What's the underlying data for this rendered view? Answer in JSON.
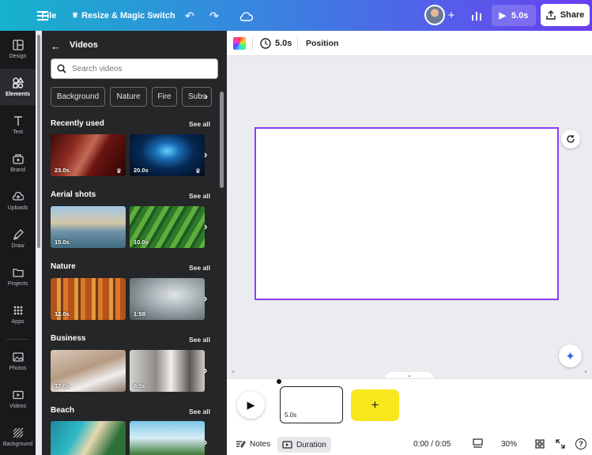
{
  "topbar": {
    "menu_icon": "hamburger-icon",
    "file_label": "File",
    "resize_label": "Resize & Magic Switch",
    "play_duration": "5.0s",
    "share_label": "Share"
  },
  "rail": {
    "items": [
      {
        "label": "Design",
        "icon": "layout-icon"
      },
      {
        "label": "Elements",
        "icon": "shapes-icon"
      },
      {
        "label": "Text",
        "icon": "text-icon"
      },
      {
        "label": "Brand",
        "icon": "brand-icon"
      },
      {
        "label": "Uploads",
        "icon": "upload-icon"
      },
      {
        "label": "Draw",
        "icon": "draw-icon"
      },
      {
        "label": "Projects",
        "icon": "folder-icon"
      },
      {
        "label": "Apps",
        "icon": "apps-icon"
      },
      {
        "label": "Photos",
        "icon": "photo-icon"
      },
      {
        "label": "Videos",
        "icon": "video-icon"
      },
      {
        "label": "Background",
        "icon": "background-icon"
      }
    ]
  },
  "panel": {
    "title": "Videos",
    "search_placeholder": "Search videos",
    "chips": [
      "Background",
      "Nature",
      "Fire",
      "Subs"
    ],
    "see_all": "See all",
    "sections": [
      {
        "title": "Recently used",
        "durations": [
          "23.0s",
          "20.0s"
        ]
      },
      {
        "title": "Aerial shots",
        "durations": [
          "15.0s",
          "10.0s"
        ]
      },
      {
        "title": "Nature",
        "durations": [
          "12.0s",
          "1:58"
        ]
      },
      {
        "title": "Business",
        "durations": [
          "17.0s",
          "8.0s"
        ]
      },
      {
        "title": "Beach",
        "durations": [
          "",
          ""
        ]
      }
    ]
  },
  "context_bar": {
    "duration": "5.0s",
    "position_label": "Position"
  },
  "timeline": {
    "clip_duration": "5.0s",
    "add_label": "+"
  },
  "footer": {
    "notes_label": "Notes",
    "duration_label": "Duration",
    "time": "0:00 / 0:05",
    "zoom": "30%",
    "help": "?"
  },
  "colors": {
    "accent": "#8b3dff",
    "add_clip": "#f8e71c",
    "panel_bg": "#252627",
    "rail_bg": "#18191b"
  }
}
